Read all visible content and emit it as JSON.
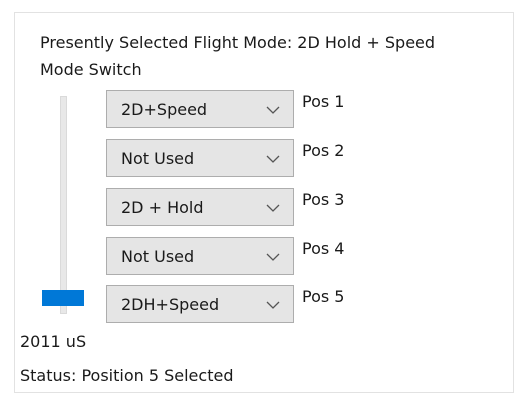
{
  "flight_mode_label": "Presently Selected Flight Mode: 2D Hold + Speed",
  "mode_switch": {
    "title": "Mode Switch",
    "slider_level": "position 5 of 5",
    "rows": [
      {
        "value": "2D+Speed",
        "pos_label": "Pos 1"
      },
      {
        "value": "Not Used",
        "pos_label": "Pos 2"
      },
      {
        "value": "2D + Hold",
        "pos_label": "Pos 3"
      },
      {
        "value": "Not Used",
        "pos_label": "Pos 4"
      },
      {
        "value": "2DH+Speed",
        "pos_label": "Pos 5"
      }
    ]
  },
  "pulse_readout": "2011 uS",
  "status": "Status: Position 5 Selected",
  "colors": {
    "accent": "#0078d7",
    "dropdown_bg": "#e5e5e5",
    "dropdown_border": "#adadad"
  },
  "icons": {
    "dropdown": "chevron-down-icon"
  }
}
